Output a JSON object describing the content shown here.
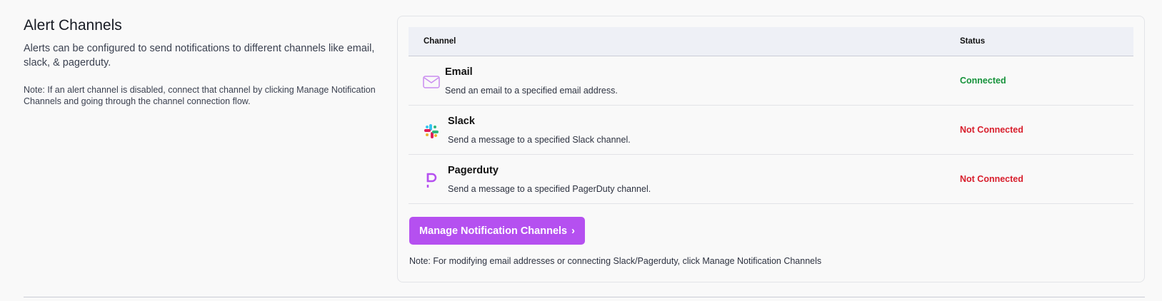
{
  "section": {
    "title": "Alert Channels",
    "description": "Alerts can be configured to send notifications to different channels like email, slack, & pagerduty.",
    "note": "Note: If an alert channel is disabled, connect that channel by clicking Manage Notification Channels and going through the channel connection flow."
  },
  "table": {
    "headers": {
      "channel": "Channel",
      "status": "Status"
    },
    "rows": [
      {
        "name": "Email",
        "description": "Send an email to a specified email address.",
        "status": "Connected",
        "icon": "mail-icon",
        "status_color": "#15923a"
      },
      {
        "name": "Slack",
        "description": "Send a message to a specified Slack channel.",
        "status": "Not Connected",
        "icon": "slack-icon",
        "status_color": "#d81e2c"
      },
      {
        "name": "Pagerduty",
        "description": "Send a message to a specified PagerDuty channel.",
        "status": "Not Connected",
        "icon": "pagerduty-icon",
        "status_color": "#d81e2c"
      }
    ]
  },
  "actions": {
    "manage_label": "Manage Notification Channels",
    "manage_chevron": "›"
  },
  "footnote": "Note: For modifying email addresses or connecting Slack/Pagerduty, click Manage Notification Channels",
  "colors": {
    "accent": "#b550f0",
    "connected": "#15923a",
    "not_connected": "#d81e2c"
  }
}
